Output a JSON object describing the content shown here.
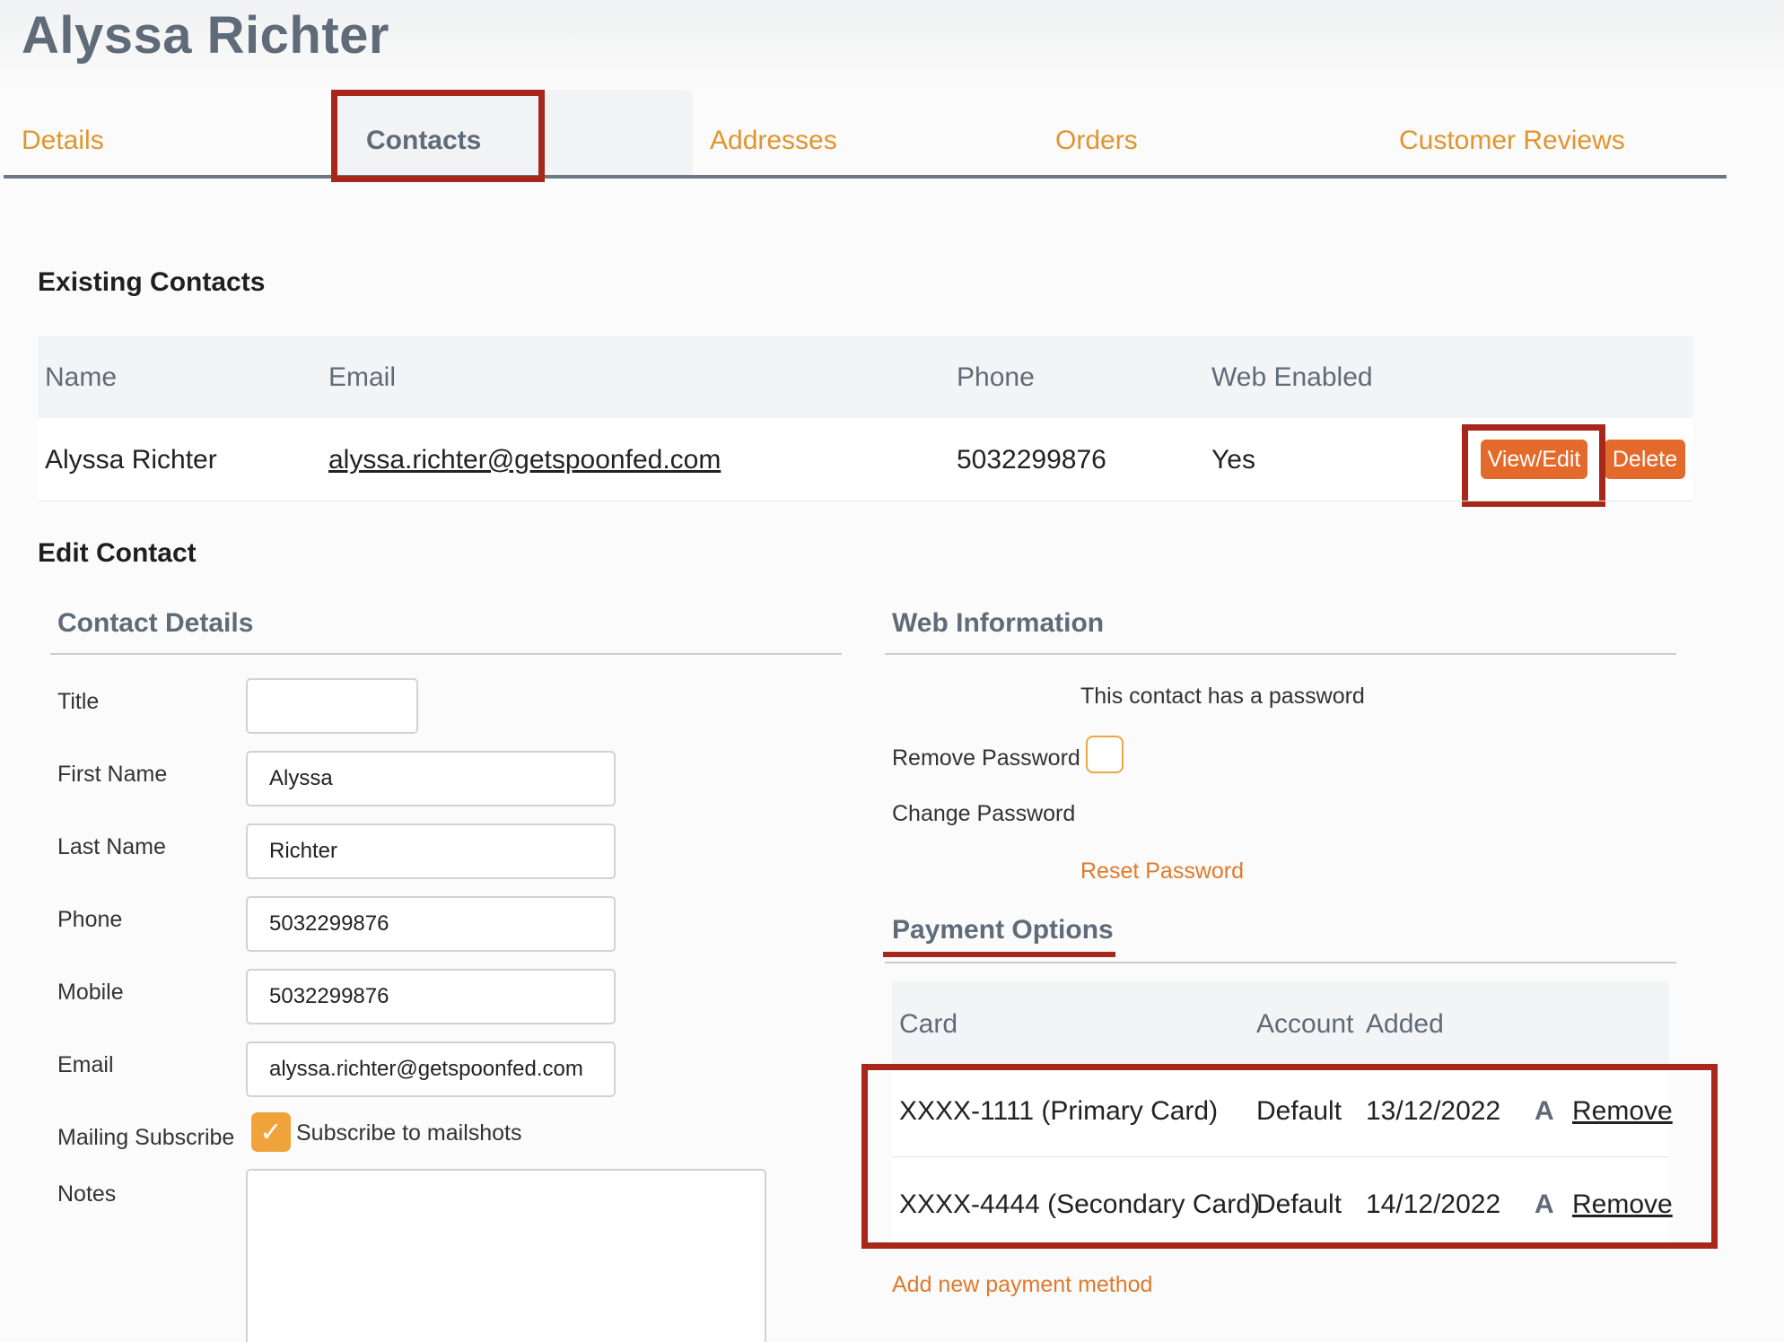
{
  "header": {
    "customer_name": "Alyssa Richter"
  },
  "tabs": [
    {
      "label": "Details"
    },
    {
      "label": "Contacts"
    },
    {
      "label": "Addresses"
    },
    {
      "label": "Orders"
    },
    {
      "label": "Customer Reviews"
    }
  ],
  "active_tab": "Contacts",
  "existing_contacts": {
    "title": "Existing Contacts",
    "columns": [
      "Name",
      "Email",
      "Phone",
      "Web Enabled"
    ],
    "rows": [
      {
        "name": "Alyssa Richter",
        "email": "alyssa.richter@getspoonfed.com",
        "phone": "5032299876",
        "web_enabled": "Yes",
        "view_edit_label": "View/Edit",
        "delete_label": "Delete"
      }
    ]
  },
  "edit_contact": {
    "title": "Edit Contact",
    "contact_details": {
      "title": "Contact Details",
      "fields": {
        "title": {
          "label": "Title",
          "value": ""
        },
        "first_name": {
          "label": "First Name",
          "value": "Alyssa"
        },
        "last_name": {
          "label": "Last Name",
          "value": "Richter"
        },
        "phone": {
          "label": "Phone",
          "value": "5032299876"
        },
        "mobile": {
          "label": "Mobile",
          "value": "5032299876"
        },
        "email": {
          "label": "Email",
          "value": "alyssa.richter@getspoonfed.com"
        },
        "mailing_subscribe": {
          "label": "Mailing Subscribe",
          "checkbox_label": "Subscribe to mailshots",
          "checked": true,
          "checkmark": "✓"
        },
        "notes": {
          "label": "Notes",
          "value": ""
        }
      }
    },
    "web_information": {
      "title": "Web Information",
      "password_status": "This contact has a password",
      "remove_password_label": "Remove Password",
      "remove_password_checked": false,
      "change_password_label": "Change Password",
      "reset_password_label": "Reset Password"
    },
    "payment_options": {
      "title": "Payment Options",
      "columns": [
        "Card",
        "Account",
        "Added"
      ],
      "rows": [
        {
          "card": "XXXX-1111 (Primary Card)",
          "account": "Default",
          "added": "13/12/2022",
          "icon_glyph": "A",
          "remove_label": "Remove"
        },
        {
          "card": "XXXX-4444 (Secondary Card)",
          "account": "Default",
          "added": "14/12/2022",
          "icon_glyph": "A",
          "remove_label": "Remove"
        }
      ],
      "add_label": "Add new payment method"
    }
  },
  "colors": {
    "accent_orange": "#e0952e",
    "button_orange": "#e46a2c",
    "heading_slate": "#5f6b78",
    "highlight_red": "#a8271b"
  }
}
